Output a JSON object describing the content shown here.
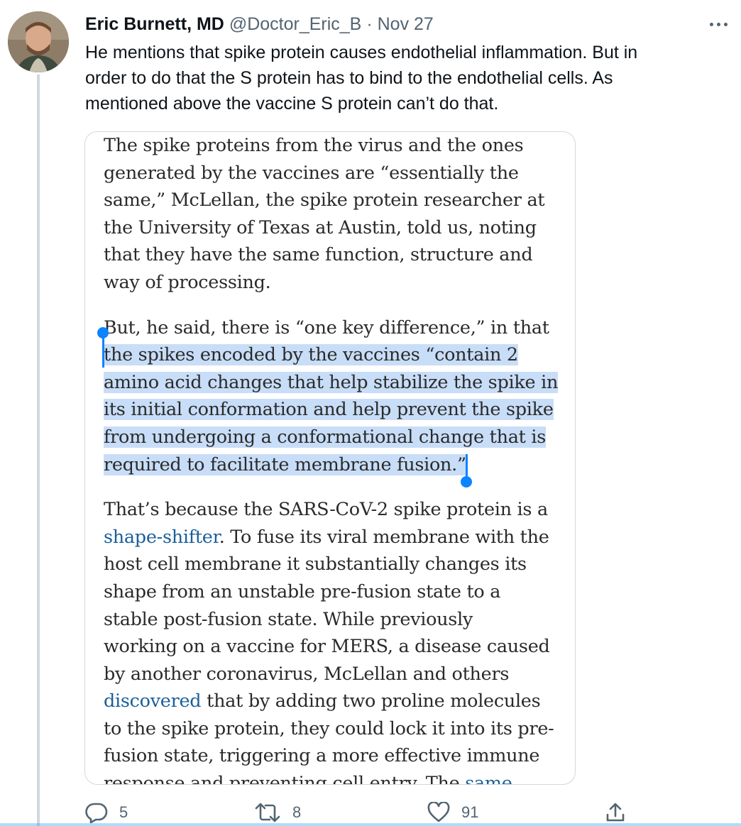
{
  "tweet": {
    "author_name": "Eric Burnett, MD",
    "handle": "@Doctor_Eric_B",
    "separator": "·",
    "date": "Nov 27",
    "text_lines": [
      "He mentions that spike protein causes endothelial inflammation. But in",
      "order to do that the S protein has to bind to the endothelial cells. As",
      "mentioned above the vaccine S protein can’t do that."
    ]
  },
  "article": {
    "p1": [
      "The spike proteins from the virus and the ones",
      "generated by the vaccines are “essentially the",
      "same,” McLellan, the spike protein researcher at",
      "the University of Texas at Austin, told us, noting",
      "that they have the same function, structure and",
      "way of processing."
    ],
    "p2_first": "But, he said, there is “one key difference,” in that",
    "p2_highlighted": [
      "the spikes encoded by the vaccines “contain 2",
      "amino acid changes that help stabilize the spike in",
      "its initial conformation and help prevent the spike",
      "from undergoing a conformational change that is",
      "required to facilitate membrane fusion.”"
    ],
    "p3": {
      "l1": "That’s because the SARS-CoV-2 spike protein is a",
      "l2_link": "shape-shifter",
      "l2_rest": ". To fuse its viral membrane with the",
      "l3": "host cell membrane it substantially changes its",
      "l4": "shape from an unstable pre-fusion state to a",
      "l5": "stable post-fusion state. While previously",
      "l6": "working on a vaccine for MERS, a disease caused",
      "l7": "by another coronavirus, McLellan and others",
      "l8_link": "discovered",
      "l8_rest": " that by adding two proline molecules",
      "l9": "to the spike protein, they could lock it into its pre-",
      "l10": "fusion state, triggering a more effective immune",
      "l11": "response and preventing cell entry. The ",
      "l11_link": "same"
    }
  },
  "actions": {
    "reply_count": "5",
    "retweet_count": "8",
    "like_count": "91"
  },
  "colors": {
    "link": "#1a5f9a",
    "highlight": "#c8ddf7",
    "selection_handle": "#0a84ff",
    "secondary_text": "#536471"
  }
}
